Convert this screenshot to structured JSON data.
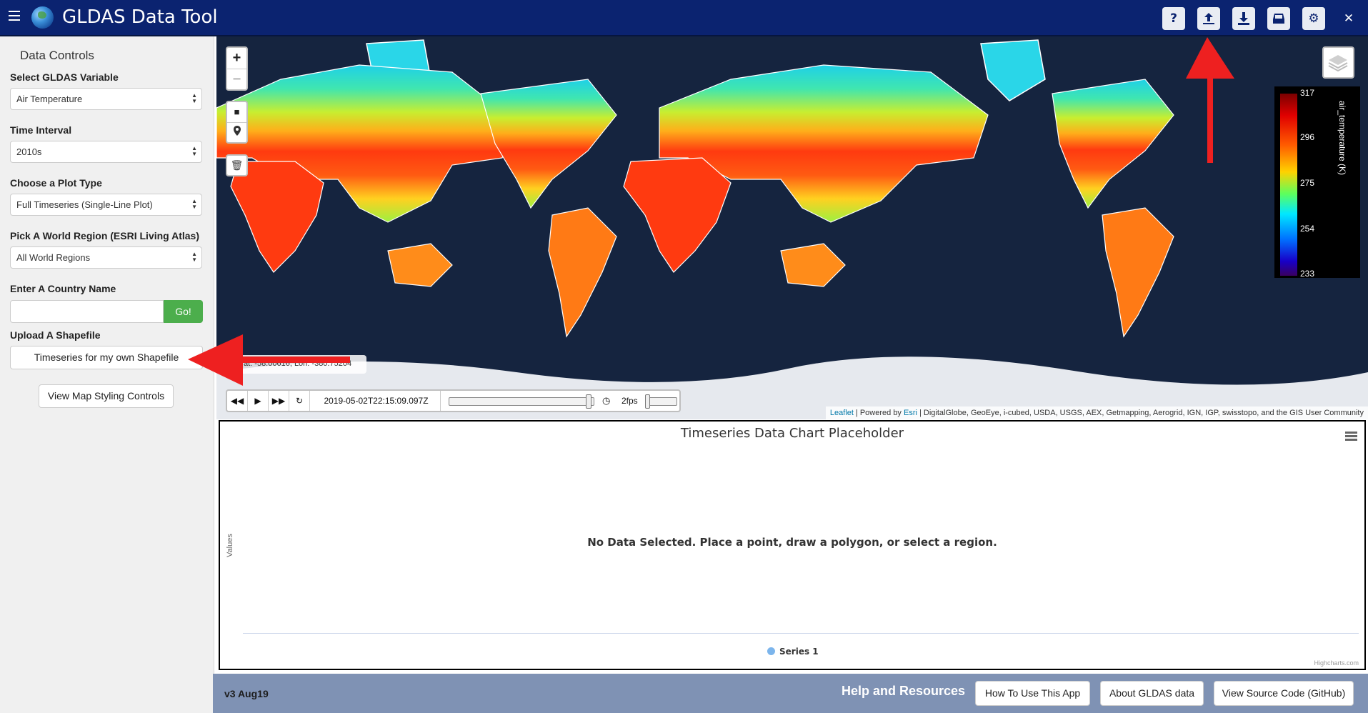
{
  "header": {
    "title": "GLDAS Data Tool",
    "icons": [
      "hamburger-menu-icon",
      "globe-logo-icon",
      "help-icon",
      "export-icon",
      "download-icon",
      "print-icon",
      "settings-icon",
      "close-icon"
    ]
  },
  "sidebar": {
    "title": "Data Controls",
    "variable_label": "Select GLDAS Variable",
    "variable_value": "Air Temperature",
    "interval_label": "Time Interval",
    "interval_value": "2010s",
    "plot_label": "Choose a Plot Type",
    "plot_value": "Full Timeseries (Single-Line Plot)",
    "region_label": "Pick A World Region (ESRI Living Atlas)",
    "region_value": "All World Regions",
    "country_label": "Enter A Country Name",
    "country_value": "",
    "go_label": "Go!",
    "shapefile_label": "Upload A Shapefile",
    "shapefile_button": "Timeseries for my own Shapefile",
    "styling_button": "View Map Styling Controls"
  },
  "map": {
    "zoom_in": "+",
    "zoom_out": "−",
    "coord_readout": "at: -58.00616, Lon: -380.75204",
    "legend": {
      "ticks": [
        "317",
        "296",
        "275",
        "254",
        "233"
      ],
      "variable": "air_temperature (K)"
    },
    "time_control": {
      "datetime": "2019-05-02T22:15:09.097Z",
      "fps": "2fps",
      "time_progress": 0.98
    },
    "attribution": {
      "leaflet": "Leaflet",
      "powered": " | Powered by ",
      "esri": "Esri",
      "sources": " | DigitalGlobe, GeoEye, i-cubed, USDA, USGS, AEX, Getmapping, Aerogrid, IGN, IGP, swisstopo, and the GIS User Community"
    }
  },
  "chart": {
    "title": "Timeseries Data Chart Placeholder",
    "ylabel": "Values",
    "no_data": "No Data Selected. Place a point, draw a polygon, or select a region.",
    "series_name": "Series 1",
    "series_color": "#7cb5ec",
    "credit": "Highcharts.com"
  },
  "footer": {
    "version": "v3 Aug19",
    "help_title": "Help and Resources",
    "buttons": [
      "How To Use This App",
      "About GLDAS data",
      "View Source Code (GitHub)"
    ]
  },
  "colors": {
    "header_bg": "#0b2370",
    "footer_bg": "#7f92b4",
    "go_green": "#4cae4c",
    "annotation_red": "#ee2020"
  }
}
